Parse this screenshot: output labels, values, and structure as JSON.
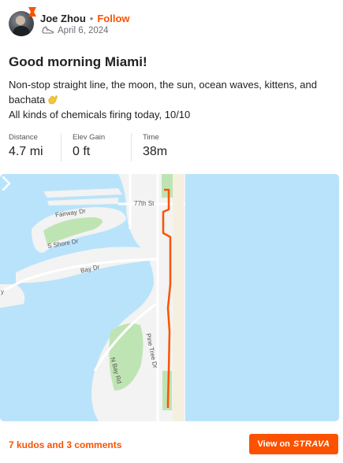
{
  "header": {
    "author": "Joe Zhou",
    "separator": "•",
    "follow_label": "Follow",
    "date": "April 6, 2024"
  },
  "activity": {
    "title": "Good morning Miami!",
    "description_line1": "Non-stop straight line, the moon, the sun, ocean waves, kittens, and",
    "description_line2": "bachata",
    "description_line3": "All kinds of chemicals firing today, 10/10"
  },
  "stats": [
    {
      "label": "Distance",
      "value": "4.7 mi"
    },
    {
      "label": "Elev Gain",
      "value": "0 ft"
    },
    {
      "label": "Time",
      "value": "38m"
    }
  ],
  "map": {
    "labels": {
      "street_77th": "77th St",
      "fairway": "Fairway Dr",
      "shore": "S Shore Dr",
      "bay": "Bay Dr",
      "pine_tree": "Pine Tree Dr",
      "n_bay": "N Bay Rd",
      "edge_y": "y"
    },
    "colors": {
      "water": "#b9e3fb",
      "land": "#f2f3f2",
      "park": "#bfe4b3",
      "route": "#fc5200"
    }
  },
  "footer": {
    "kudos_comments": "7 kudos and 3 comments",
    "view_on": "View on",
    "brand": "STRAVA"
  }
}
